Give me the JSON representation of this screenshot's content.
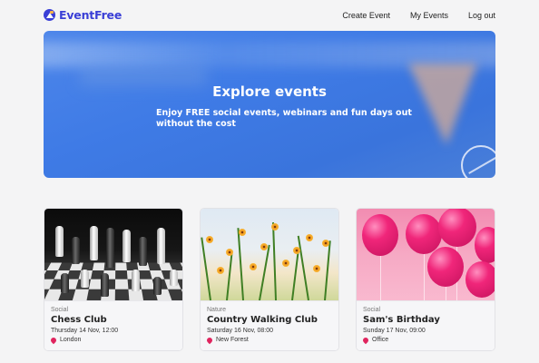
{
  "app": {
    "brand": "EventFree"
  },
  "nav": {
    "links": [
      "Create Event",
      "My Events",
      "Log out"
    ]
  },
  "hero": {
    "title": "Explore events",
    "subtitle": "Enjoy FREE social events, webinars and fun days out without the cost"
  },
  "events": [
    {
      "category": "Social",
      "title": "Chess Club",
      "datetime": "Thursday 14 Nov, 12:00",
      "location": "London",
      "image_icon": "chess-image"
    },
    {
      "category": "Nature",
      "title": "Country Walking Club",
      "datetime": "Saturday 16 Nov, 08:00",
      "location": "New Forest",
      "image_icon": "flowers-image"
    },
    {
      "category": "Social",
      "title": "Sam's Birthday",
      "datetime": "Sunday 17 Nov, 09:00",
      "location": "Office",
      "image_icon": "balloons-image"
    }
  ],
  "colors": {
    "brand": "#3a3fd6",
    "hero": "#3f7be6",
    "pin": "#e0245e",
    "background": "#f4f4f5"
  }
}
